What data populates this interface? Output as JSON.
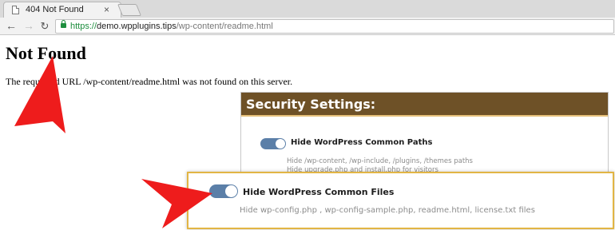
{
  "browser": {
    "tab_title": "404 Not Found",
    "tab_close": "×",
    "nav_back": "←",
    "nav_forward": "→",
    "nav_reload": "↻",
    "url_scheme": "https://",
    "url_host": "demo.wpplugins.tips",
    "url_path": "/wp-content/readme.html"
  },
  "page": {
    "heading": "Not Found",
    "message": "The requested URL /wp-content/readme.html was not found on this server."
  },
  "security_panel": {
    "title": "Security Settings:",
    "options": [
      {
        "label": "Hide WordPress Common Paths",
        "enabled": true,
        "description_lines": [
          "Hide /wp-content, /wp-include, /plugins, /themes paths",
          "Hide upgrade.php and install.php for visitors"
        ]
      },
      {
        "label": "Hide WordPress Common Files",
        "enabled": true,
        "description_lines": [
          "Hide wp-config.php , wp-config-sample.php, readme.html, license.txt files"
        ]
      }
    ]
  },
  "colors": {
    "panel_header": "#6e5127",
    "toggle_on": "#5b7fa8",
    "highlight_border": "#e2b544",
    "annotation_arrow": "#ee1c1c"
  }
}
